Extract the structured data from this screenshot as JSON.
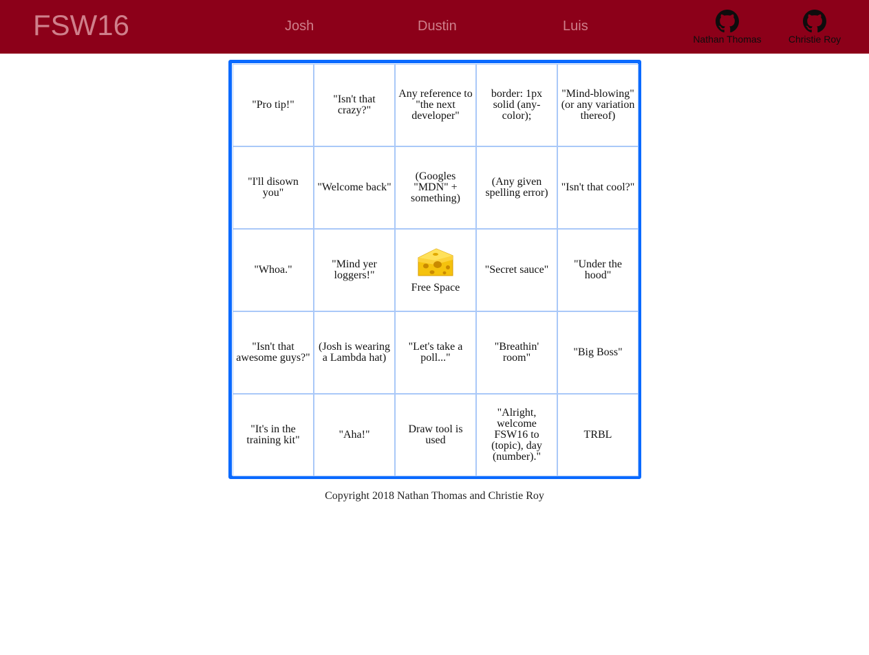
{
  "header": {
    "logo": "FSW16",
    "nav": [
      "Josh",
      "Dustin",
      "Luis"
    ],
    "github_links": [
      "Nathan Thomas",
      "Christie Roy"
    ]
  },
  "board": {
    "cells": [
      "\"Pro tip!\"",
      "\"Isn't that crazy?\"",
      "Any reference to \"the next developer\"",
      "border: 1px solid (any-color);",
      "\"Mind-blowing\" (or any variation thereof)",
      "\"I'll disown you\"",
      "\"Welcome back\"",
      "(Googles \"MDN\" + something)",
      "(Any given spelling error)",
      "\"Isn't that cool?\"",
      "\"Whoa.\"",
      "\"Mind yer loggers!\"",
      "Free Space",
      "\"Secret sauce\"",
      "\"Under the hood\"",
      "\"Isn't that awesome guys?\"",
      "(Josh is wearing a Lambda hat)",
      "\"Let's take a poll...\"",
      "\"Breathin' room\"",
      "\"Big Boss\"",
      "\"It's in the training kit\"",
      "\"Aha!\"",
      "Draw tool is used",
      "\"Alright, welcome FSW16 to (topic), day (number).\"",
      "TRBL"
    ],
    "free_space_icon": "cheese-icon"
  },
  "footer": {
    "copyright": "Copyright 2018 Nathan Thomas and Christie Roy"
  },
  "colors": {
    "header_bg": "#8c0019",
    "header_text": "#cf7f8b",
    "board_border": "#0a6aff",
    "cell_border": "#a9c8f8"
  }
}
